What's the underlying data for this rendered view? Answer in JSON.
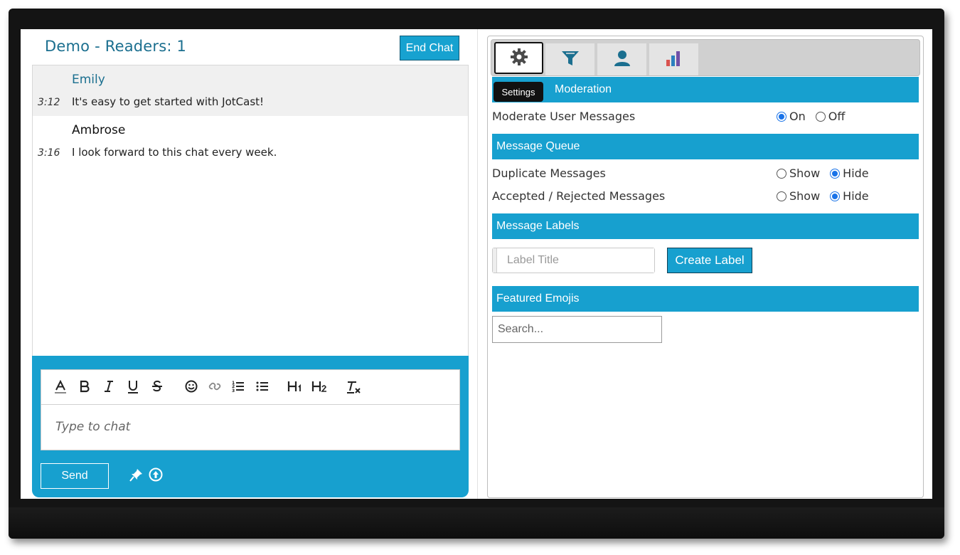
{
  "chat": {
    "title": "Demo - Readers: 1",
    "end_chat_label": "End Chat",
    "messages": [
      {
        "author": "Emily",
        "author_color": "#1b6f8f",
        "time": "3:12",
        "text": "It's easy to get started with JotCast!",
        "highlighted": true
      },
      {
        "author": "Ambrose",
        "author_color": "#111111",
        "time": "3:16",
        "text": "I look forward to this chat every week.",
        "highlighted": false
      }
    ],
    "composer": {
      "placeholder": "Type to chat",
      "send_label": "Send",
      "toolbar": [
        "text-color-icon",
        "bold-icon",
        "italic-icon",
        "underline-icon",
        "strikethrough-icon",
        "emoji-icon",
        "link-icon",
        "ordered-list-icon",
        "bullet-list-icon",
        "heading-1-icon",
        "heading-2-icon",
        "clear-format-icon"
      ]
    }
  },
  "settings": {
    "tabs": [
      {
        "icon": "gear-icon",
        "active": true
      },
      {
        "icon": "filter-icon",
        "active": false
      },
      {
        "icon": "user-icon",
        "active": false
      },
      {
        "icon": "bar-chart-icon",
        "active": false
      }
    ],
    "tooltip": "Settings",
    "sections": {
      "moderation": {
        "title": "Moderation",
        "rows": [
          {
            "label": "Moderate User Messages",
            "options": [
              "On",
              "Off"
            ],
            "selected": "On"
          }
        ]
      },
      "queue": {
        "title": "Message Queue",
        "rows": [
          {
            "label": "Duplicate Messages",
            "options": [
              "Show",
              "Hide"
            ],
            "selected": "Hide"
          },
          {
            "label": "Accepted / Rejected Messages",
            "options": [
              "Show",
              "Hide"
            ],
            "selected": "Hide"
          }
        ]
      },
      "labels": {
        "title": "Message Labels",
        "input_placeholder": "Label Title",
        "create_label": "Create Label"
      },
      "emojis": {
        "title": "Featured Emojis",
        "search_placeholder": "Search..."
      }
    },
    "accent_color": "#17a0cf"
  }
}
